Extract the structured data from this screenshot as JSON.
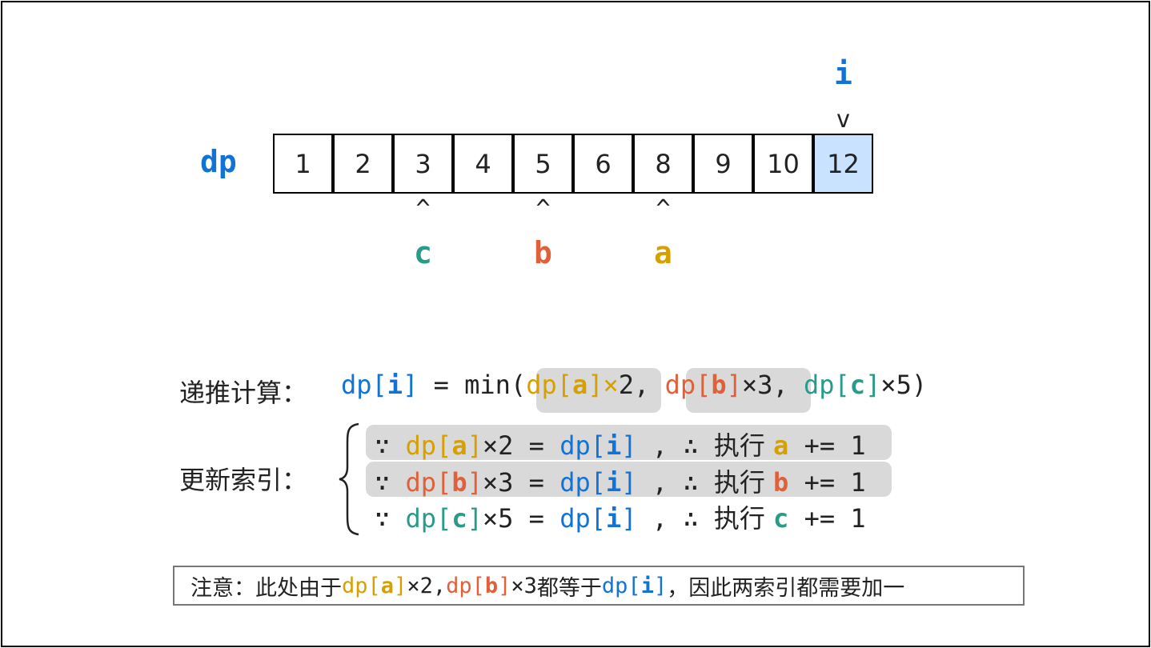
{
  "dp_label": "dp",
  "dp_values": [
    "1",
    "2",
    "3",
    "4",
    "5",
    "6",
    "8",
    "9",
    "10",
    "12"
  ],
  "highlight_index": 9,
  "pointer_i": {
    "label": "i",
    "caret": "v"
  },
  "pointers": [
    {
      "label": "c",
      "index": 2,
      "color": "#2a9a8a",
      "caret": "^"
    },
    {
      "label": "b",
      "index": 4,
      "color": "#e0603a",
      "caret": "^"
    },
    {
      "label": "a",
      "index": 6,
      "color": "#d6a000",
      "caret": "^"
    }
  ],
  "recurrence": {
    "label": "递推计算：",
    "lhs_dp": "dp[",
    "lhs_i": "i",
    "lhs_close": "]",
    "eq_min": " = min(",
    "t1_dp": "dp[",
    "t1_var": "a",
    "t1_close": "]×",
    "t1_mult": "2",
    "sep1": ", ",
    "t2_dp": "dp[",
    "t2_var": "b",
    "t2_close": "]",
    "t2_mult": "×3",
    "sep2": ", ",
    "t3_dp": "dp[",
    "t3_var": "c",
    "t3_close": "]",
    "t3_mult": "×5)"
  },
  "update": {
    "label": "更新索引：",
    "brace": "{",
    "because": "∵ ",
    "rows": [
      {
        "dp": "dp[",
        "var": "a",
        "close": "]",
        "mult": "×2 = ",
        "rhs_dp": "dp[",
        "rhs_i": "i",
        "rhs_close": "]",
        "therefore": " , ∴ ",
        "exec": "执行 ",
        "target": "a",
        "op": " += 1"
      },
      {
        "dp": "dp[",
        "var": "b",
        "close": "]",
        "mult": "×3 = ",
        "rhs_dp": "dp[",
        "rhs_i": "i",
        "rhs_close": "]",
        "therefore": " , ∴ ",
        "exec": "执行 ",
        "target": "b",
        "op": " += 1"
      },
      {
        "dp": "dp[",
        "var": "c",
        "close": "]",
        "mult": "×5 = ",
        "rhs_dp": "dp[",
        "rhs_i": "i",
        "rhs_close": "]",
        "therefore": " , ∴ ",
        "exec": "执行 ",
        "target": "c",
        "op": " += 1"
      }
    ]
  },
  "note": {
    "prefix": "注意：此处由于 ",
    "a_dp": "dp[",
    "a_var": "a",
    "a_close": "]",
    "a_mult": "×2, ",
    "b_dp": "dp[",
    "b_var": "b",
    "b_close": "]",
    "b_mult": "×3 ",
    "mid": "都等于 ",
    "i_dp": "dp[",
    "i_var": "i",
    "i_close": "]",
    "suffix": " ，因此两索引都需要加一"
  },
  "colors": {
    "i": "#1273d6",
    "a": "#d6a000",
    "b": "#e0603a",
    "c": "#2a9a8a",
    "highlight_cell": "#c8e2ff",
    "highlight_box": "#d9d9d9"
  }
}
